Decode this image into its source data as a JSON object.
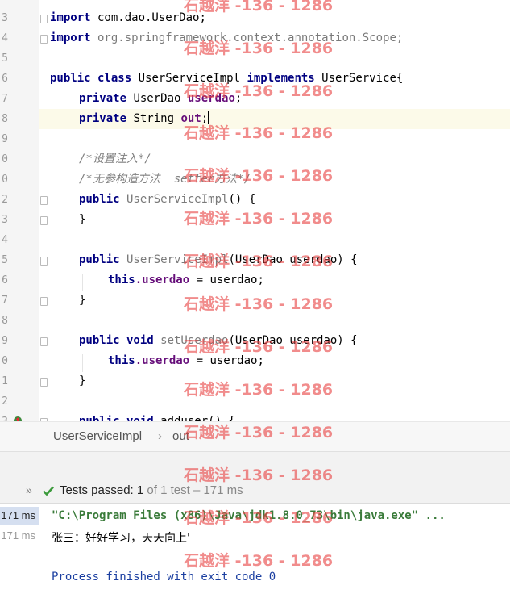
{
  "editor": {
    "line_numbers": [
      "3",
      "4",
      "5",
      "6",
      "7",
      "8",
      "9",
      "0",
      "0",
      "2",
      "3",
      "4",
      "5",
      "6",
      "7",
      "8",
      "9",
      "0",
      "1",
      "2",
      "3"
    ],
    "lines": {
      "l1_kw": "import",
      "l1_rest": " com.dao.UserDao;",
      "l2_kw": "import",
      "l2_rest": " org.springframework.context.annotation.Scope;",
      "l4_kw1": "public class",
      "l4_name": " UserServiceImpl ",
      "l4_kw2": "implements",
      "l4_rest": " UserService{",
      "l5_kw": "private",
      "l5_type": " UserDao ",
      "l5_field": "userdao",
      "l5_end": ";",
      "l6_kw": "private",
      "l6_type": " String ",
      "l6_field": "out",
      "l6_end": ";",
      "l8_cmt": "/*设置注入*/",
      "l9_cmt": "/*无参构造方法  setter方法*/",
      "l10_kw": "public",
      "l10_name": " UserServiceImpl",
      "l10_rest": "() {",
      "l11_rest": "}",
      "l13_kw": "public",
      "l13_name": " UserServiceImpl",
      "l13_rest": "(UserDao userdao) {",
      "l14_kw": "this",
      "l14_field": ".userdao",
      "l14_rest": " = userdao;",
      "l15_rest": "}",
      "l17_kw": "public void",
      "l17_name": " setUserdao",
      "l17_rest": "(UserDao userdao) {",
      "l18_kw": "this",
      "l18_field": ".userdao",
      "l18_rest": " = userdao;",
      "l19_rest": "}",
      "l21_kw": "public void",
      "l21_rest": " adduser() {"
    }
  },
  "breadcrumb": {
    "class_name": "UserServiceImpl",
    "separator": "›",
    "member": "out"
  },
  "tests": {
    "status": "Tests passed:",
    "count": "1",
    "rest": "of 1 test – 171 ms"
  },
  "run": {
    "times": [
      "171 ms",
      "171 ms"
    ],
    "command": "\"C:\\Program Files (x86)\\Java\\jdk1.8.0_73\\bin\\java.exe\" ...",
    "output": "张三：好好学习，天天向上'",
    "finished": "Process finished with exit code 0"
  },
  "watermark": {
    "text": "石越洋 -136 - 1286"
  },
  "colors": {
    "keyword": "#000080",
    "field": "#660e7a",
    "comment": "#808080",
    "pass": "#3b9a3b",
    "watermark": "#e84646"
  }
}
